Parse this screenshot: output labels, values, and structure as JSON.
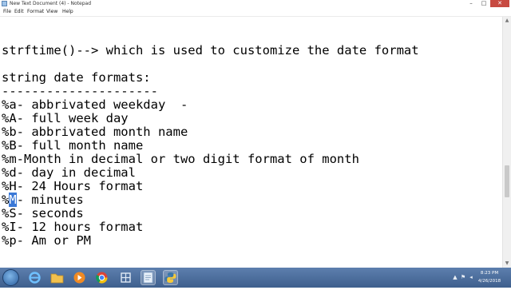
{
  "window": {
    "title": "New Text Document (4) - Notepad",
    "minimize_glyph": "–",
    "maximize_glyph": "□",
    "close_glyph": "✕"
  },
  "menu": {
    "items": [
      "File",
      "Edit",
      "Format",
      "View",
      "Help"
    ]
  },
  "document": {
    "line1": "strftime()--> which is used to customize the date format",
    "line2": "",
    "line3": "string date formats:",
    "line4": "---------------------",
    "line5": "%a- abbrivated weekday  -",
    "line6": "%A- full week day",
    "line7": "%b- abbrivated month name",
    "line8": "%B- full month name",
    "line9": "%m-Month in decimal or two digit format of month",
    "line10": "%d- day in decimal",
    "line11": "%H- 24 Hours format",
    "line12_prefix": "%",
    "line12_selected": "M",
    "line12_suffix": "- minutes",
    "line13": "%S- seconds",
    "line14": "%I- 12 hours format",
    "line15": "%p- Am or PM"
  },
  "scrollbar": {
    "up_glyph": "▲",
    "down_glyph": "▼"
  },
  "taskbar": {
    "pinned_icons": [
      "ie-icon",
      "folder-icon",
      "media-player-icon",
      "chrome-icon",
      "network-icon",
      "notepad-icon",
      "python-icon"
    ],
    "clock_time": "8:23 PM",
    "clock_date": "4/26/2018"
  },
  "colors": {
    "selection": "#3a78d6",
    "taskbar": "#4a6c9b",
    "close_button": "#c74a41"
  }
}
